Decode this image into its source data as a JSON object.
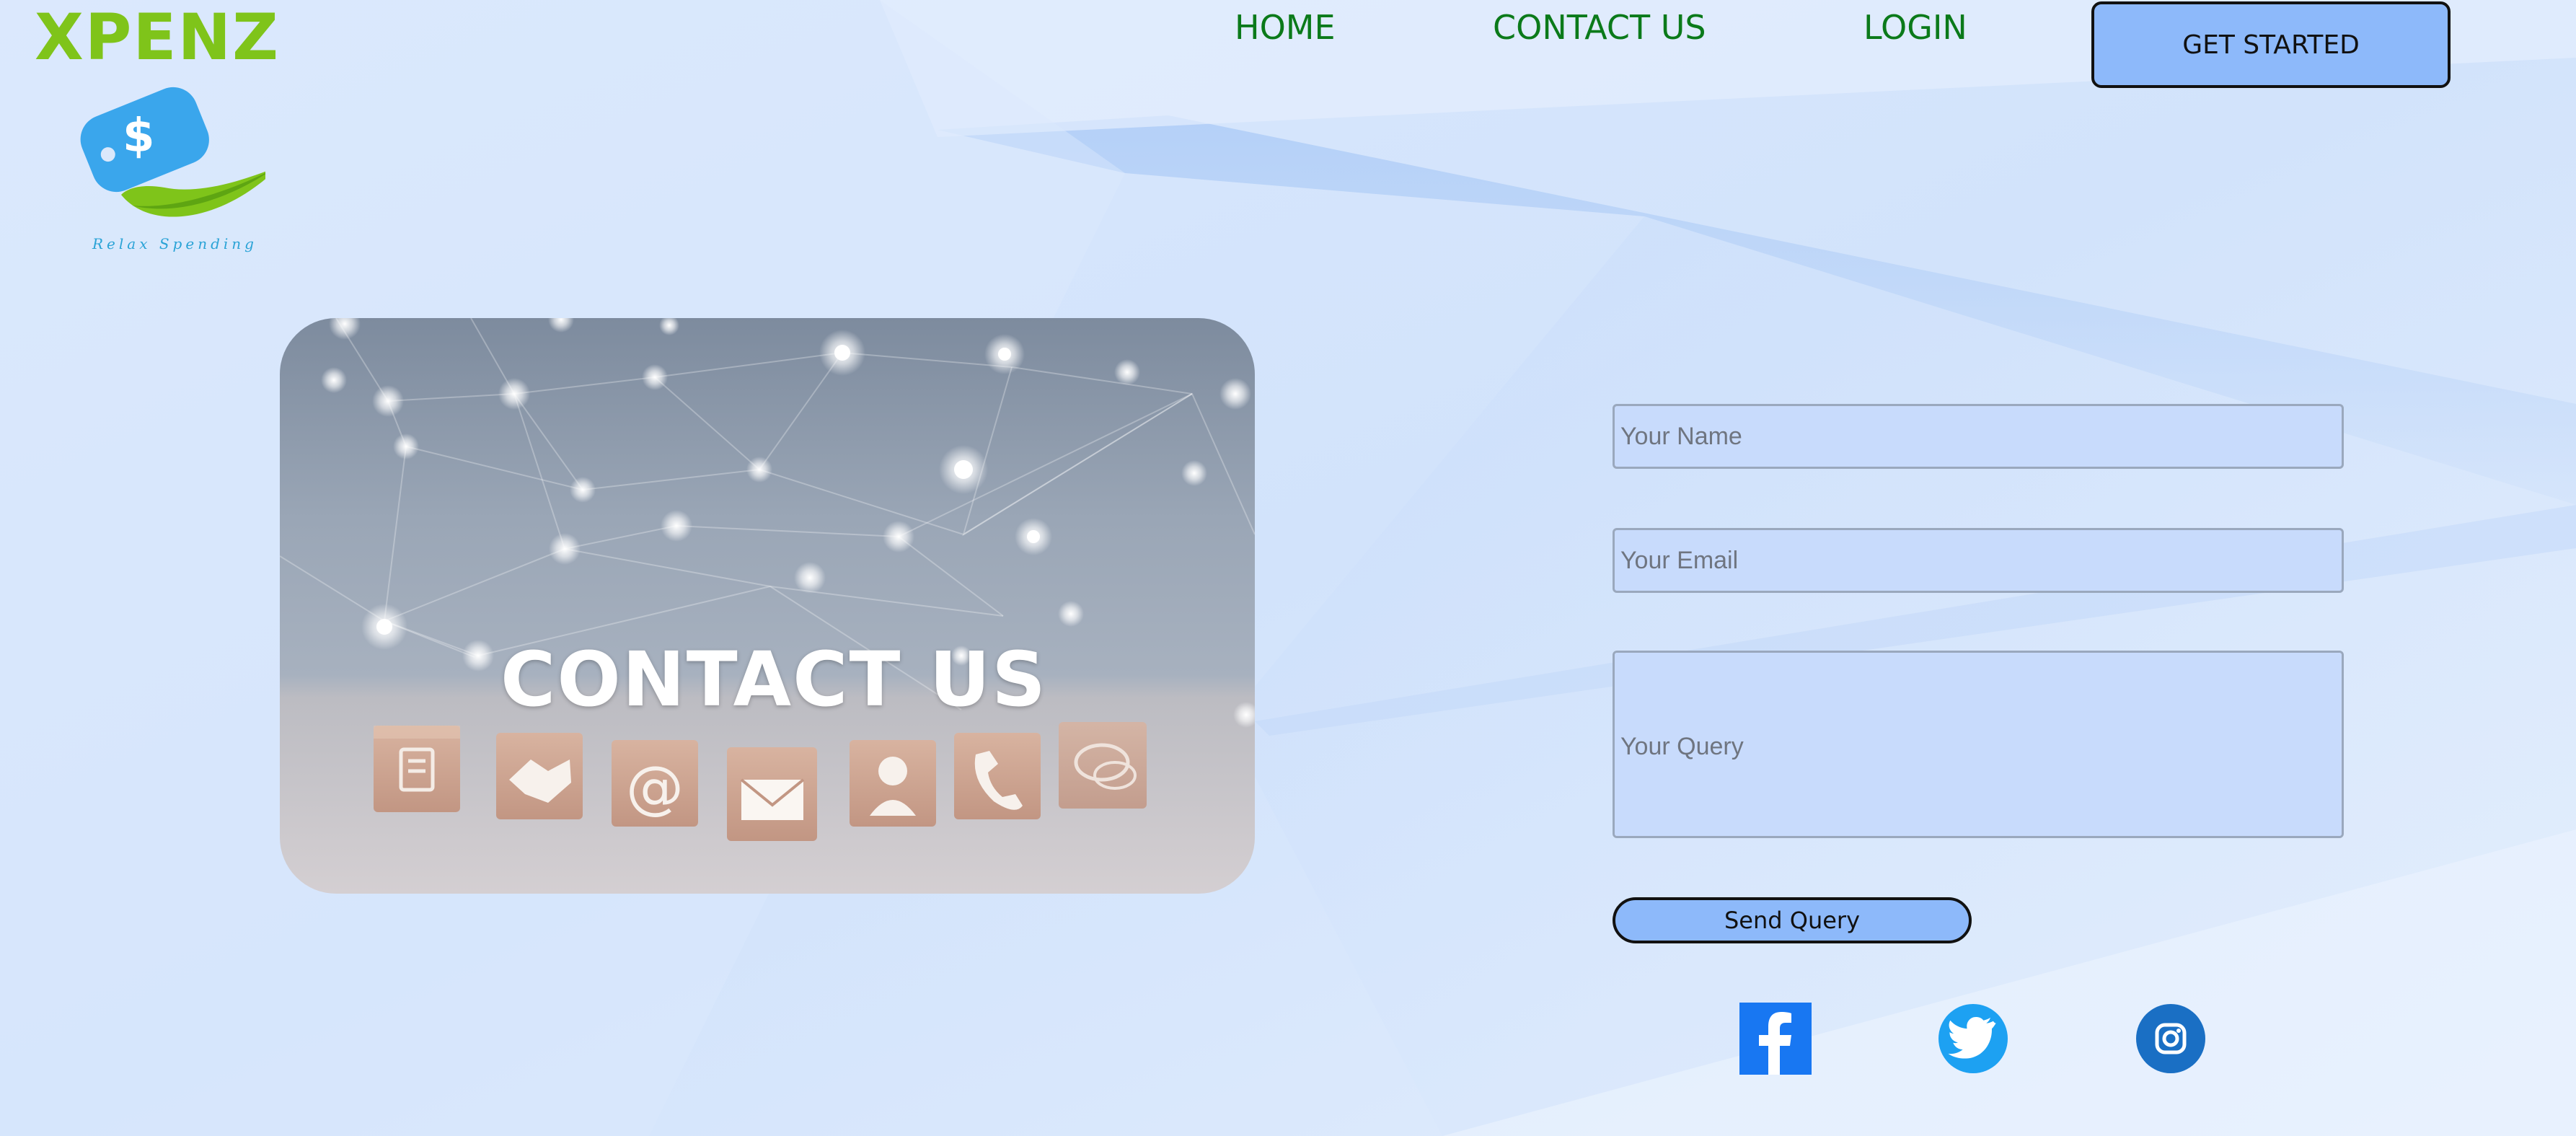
{
  "brand": {
    "name": "XPENZ",
    "tagline": "Relax Spending",
    "logo_icon": "dollar-tag-leaf-icon",
    "logo_symbol": "$",
    "colors": {
      "name": "#7fc41a",
      "tag": "#3aa6ec",
      "leaf": "#7fc41a",
      "tagline": "#2aa3d6"
    }
  },
  "nav": {
    "home": "HOME",
    "contact": "CONTACT US",
    "login": "LOGIN",
    "cta": "GET STARTED",
    "link_color": "#0b7a1a",
    "cta_color": "#8db9fa"
  },
  "hero": {
    "image_text": "CONTACT US",
    "block_icons": [
      "document-icon",
      "handshake-icon",
      "at-sign-icon",
      "envelope-icon",
      "support-agent-icon",
      "phone-icon",
      "chat-bubbles-icon"
    ],
    "at_symbol": "@"
  },
  "form": {
    "name_placeholder": "Your Name",
    "email_placeholder": "Your Email",
    "query_placeholder": "Your Query",
    "submit_label": "Send Query",
    "field_color": "#c8dbfc"
  },
  "social": [
    {
      "name": "Facebook",
      "icon": "facebook-icon",
      "color": "#1877f2"
    },
    {
      "name": "Twitter",
      "icon": "twitter-icon",
      "color": "#1da1f2"
    },
    {
      "name": "Instagram",
      "icon": "instagram-icon",
      "color": "#1a6fc4"
    }
  ]
}
